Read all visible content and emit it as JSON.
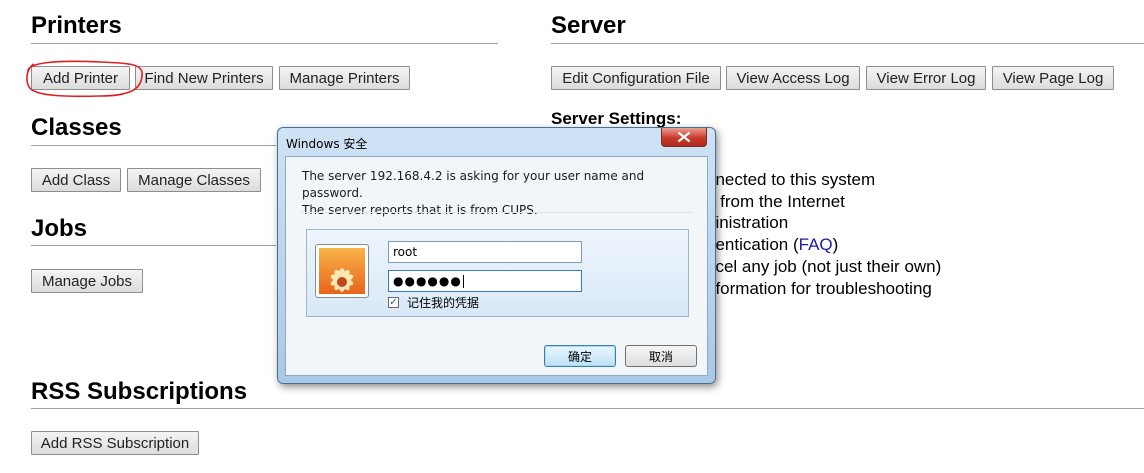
{
  "printers": {
    "title": "Printers",
    "buttons": [
      "Add Printer",
      "Find New Printers",
      "Manage Printers"
    ]
  },
  "classes": {
    "title": "Classes",
    "buttons": [
      "Add Class",
      "Manage Classes"
    ]
  },
  "jobs": {
    "title": "Jobs",
    "buttons": [
      "Manage Jobs"
    ]
  },
  "rss": {
    "title": "RSS Subscriptions",
    "buttons": [
      "Add RSS Subscription"
    ]
  },
  "server": {
    "title": "Server",
    "buttons": [
      "Edit Configuration File",
      "View Access Log",
      "View Error Log",
      "View Page Log"
    ],
    "settings_label": "Server Settings:",
    "settings_lines": [
      "nnected to this system",
      "g from the Internet",
      "ninistration",
      "hentication (",
      "ncel any job (not just their own)",
      "nformation for troubleshooting"
    ],
    "faq_link": "FAQ",
    "faq_suffix": ")"
  },
  "dialog": {
    "title": "Windows 安全",
    "message_line1": "The server 192.168.4.2 is asking for your user name and password.",
    "message_line2": "The server reports that it is from CUPS.",
    "username_value": "root",
    "password_value": "●●●●●●",
    "remember_label": "记住我的凭据",
    "remember_checked": true,
    "ok_label": "确定",
    "cancel_label": "取消"
  },
  "colors": {
    "annotation_circle": "#e02020",
    "link": "#1a1aa6"
  },
  "icons": {
    "close": "close-icon",
    "user_avatar": "flower-avatar-icon",
    "checkbox": "checkmark-icon"
  }
}
